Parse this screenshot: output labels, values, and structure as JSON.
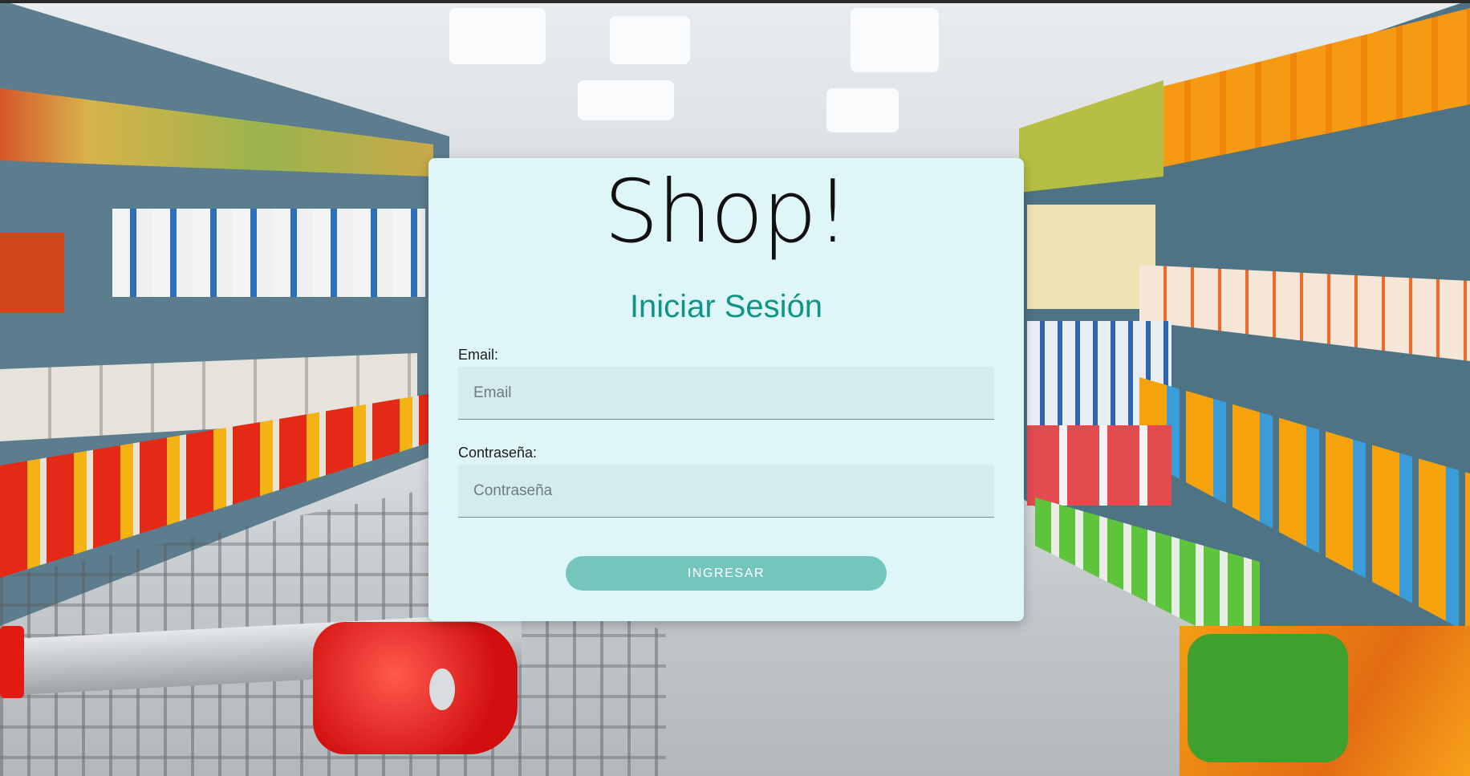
{
  "app": {
    "brand_title": "Shop!"
  },
  "login": {
    "heading": "Iniciar Sesión",
    "email": {
      "label": "Email:",
      "placeholder": "Email",
      "value": ""
    },
    "password": {
      "label": "Contraseña:",
      "placeholder": "Contraseña",
      "value": ""
    },
    "submit_label": "INGRESAR"
  },
  "colors": {
    "card_background": "#dff6f9",
    "heading": "#119488",
    "button": "#74c6bd",
    "input_background": "#d4ecef"
  },
  "background": {
    "description_icon": "supermarket-aisle-image"
  }
}
